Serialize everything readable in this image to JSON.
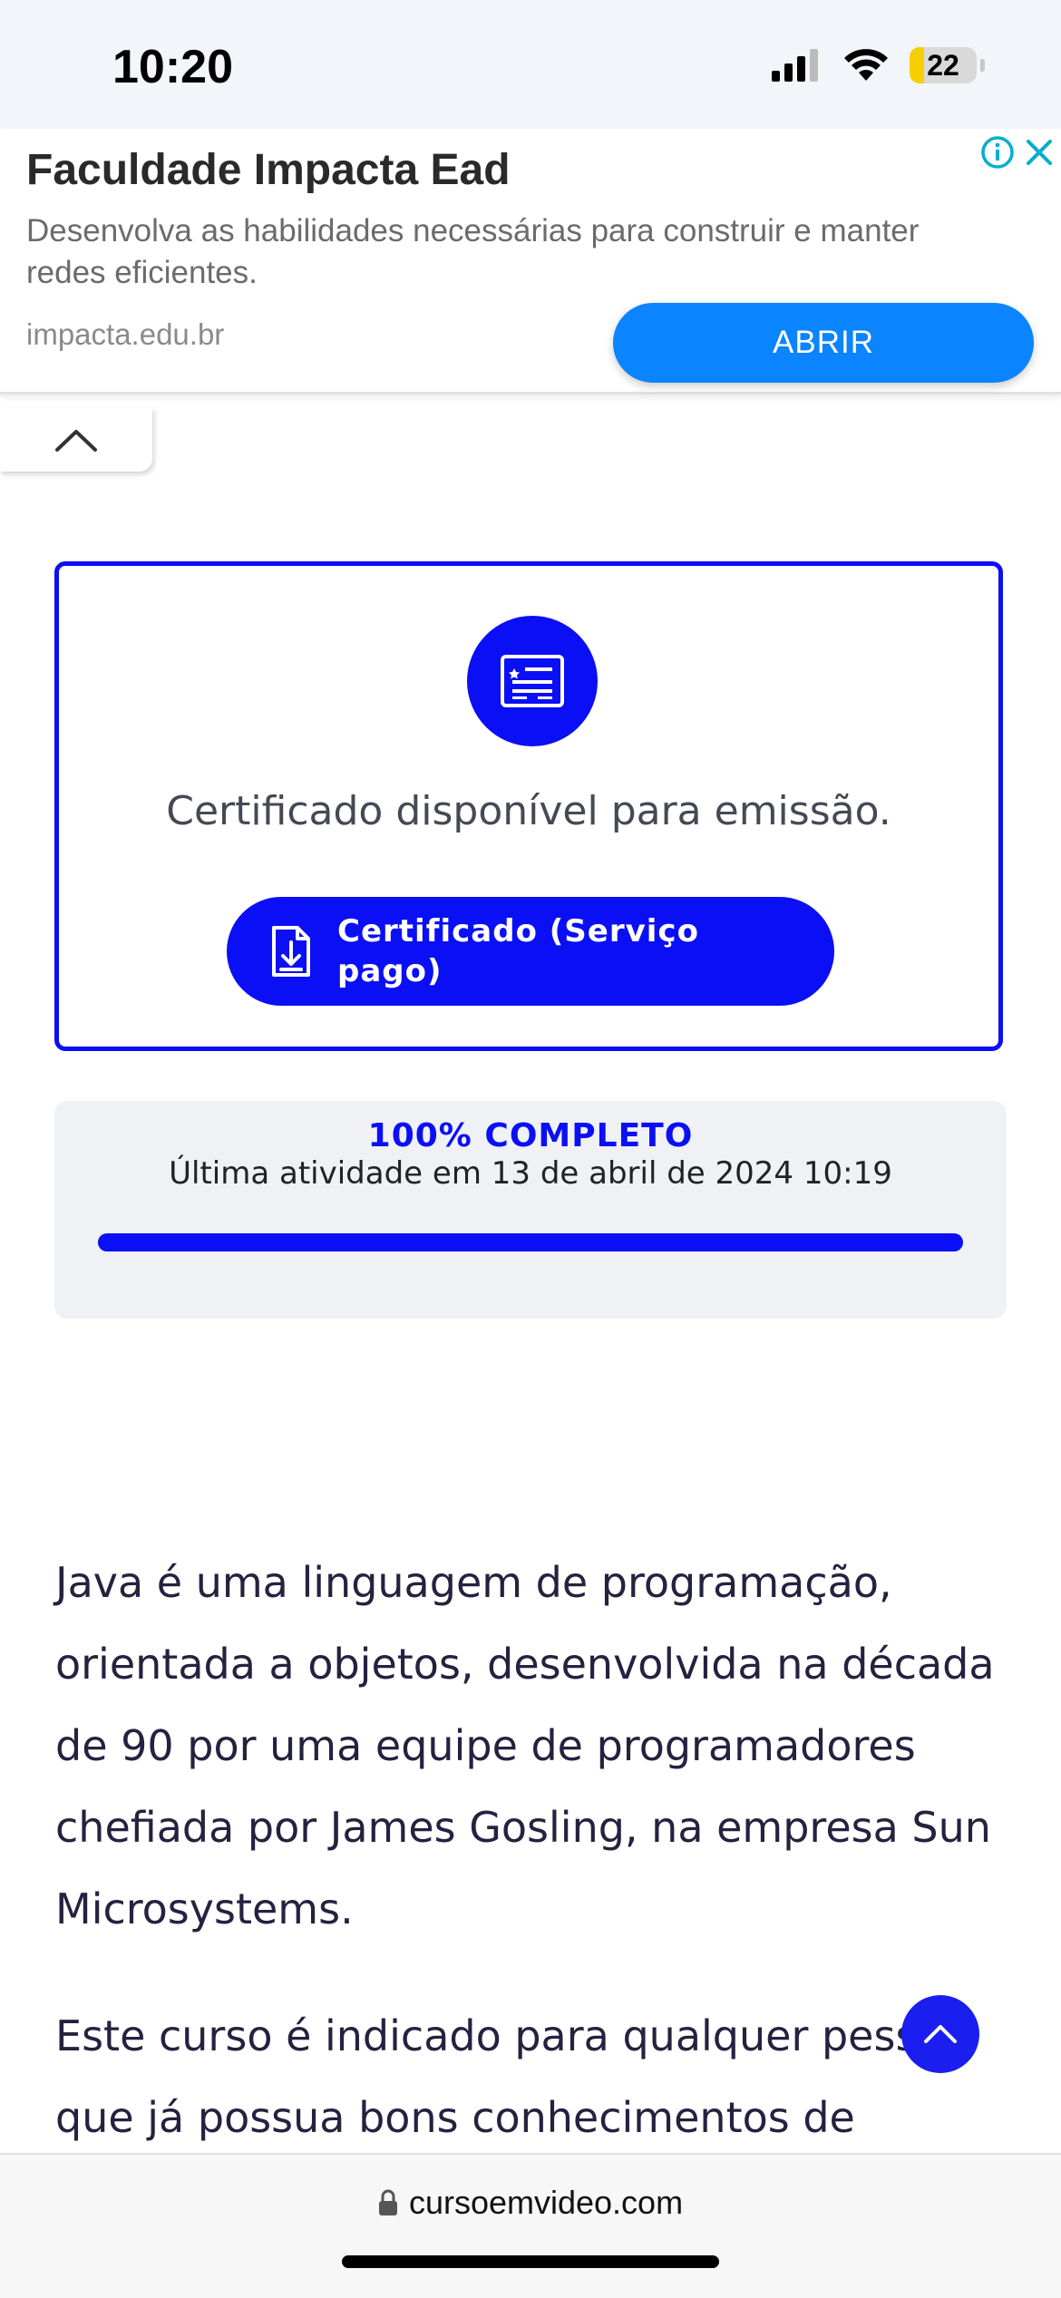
{
  "status_bar": {
    "time": "10:20",
    "battery": "22",
    "icons": [
      "signal-icon",
      "wifi-icon",
      "battery-icon"
    ]
  },
  "ad": {
    "title": "Faculdade Impacta Ead",
    "description": "Desenvolva as habilidades necessárias para construir e manter redes eficientes.",
    "domain": "impacta.edu.br",
    "open_label": "ABRIR",
    "icons": [
      "info-icon",
      "close-icon",
      "chevron-up-icon"
    ]
  },
  "certificate": {
    "message": "Certificado disponível para emissão.",
    "button_label": "Certificado (Serviço pago)",
    "icons": [
      "certificate-icon",
      "download-file-icon"
    ]
  },
  "progress": {
    "title": "100% COMPLETO",
    "last_activity": "Última atividade em 13 de abril de 2024 10:19",
    "percent": 100
  },
  "course": {
    "paragraphs": [
      "Java é uma linguagem de programação, orientada a objetos, desenvolvida na década de 90 por uma equipe de programadores chefiada por James Gosling, na empresa Sun Microsystems.",
      "Este curso é indicado para qualquer pessoa que já possua bons conhecimentos de algoritmos e"
    ]
  },
  "browser": {
    "url": "cursoemvideo.com"
  },
  "colors": {
    "brand_blue": "#0b0ff5",
    "ad_button": "#0a84ff"
  }
}
